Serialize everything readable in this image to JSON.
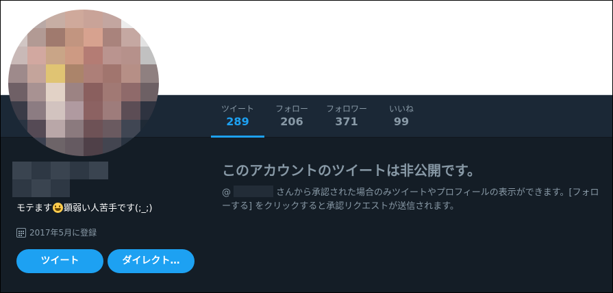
{
  "profile": {
    "bio_prefix": "モテます",
    "bio_suffix": "顕弱い人苦手です(;_;)",
    "joined": "2017年5月に登録",
    "tweet_button": "ツイート",
    "dm_button": "ダイレクト…"
  },
  "stats": [
    {
      "label": "ツイート",
      "value": "289"
    },
    {
      "label": "フォロー",
      "value": "206"
    },
    {
      "label": "フォロワー",
      "value": "371"
    },
    {
      "label": "いいね",
      "value": "99"
    }
  ],
  "protected": {
    "title": "このアカウントのツイートは非公開です。",
    "at": "@",
    "message": "さんから承認された場合のみツイートやプロフィールの表示ができます。[フォローする] をクリックすると承認リクエストが送信されます。"
  },
  "colors": {
    "accent": "#1da1f2",
    "background": "#141d26",
    "nav_background": "#1b2836",
    "muted_text": "#8899a6"
  },
  "icons": [
    "calendar-icon",
    "grinning-emoji-icon"
  ]
}
